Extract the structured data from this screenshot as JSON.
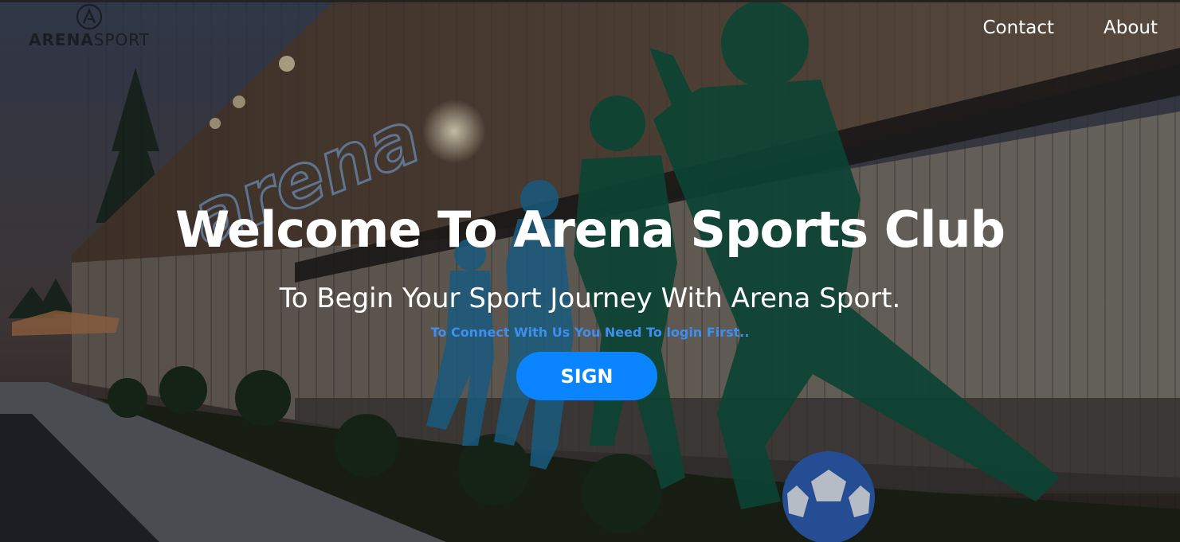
{
  "header": {
    "logo": {
      "bold_text": "ARENA",
      "light_text": "SPORT",
      "mark": "circle-a-icon"
    },
    "nav": [
      {
        "label": "Contact"
      },
      {
        "label": "About"
      }
    ]
  },
  "hero": {
    "background": "arena-sports-building-photo",
    "title": "Welcome To Arena Sports Club",
    "subtitle": "To Begin Your Sport Journey With Arena Sport.",
    "note": "To Connect With Us You Need To login First..",
    "cta_label": "SIGN"
  },
  "colors": {
    "accent": "#0a84ff",
    "note_text": "#3d8ff0",
    "mural_green": "#10533f",
    "mural_blue": "#1f6e9a"
  }
}
